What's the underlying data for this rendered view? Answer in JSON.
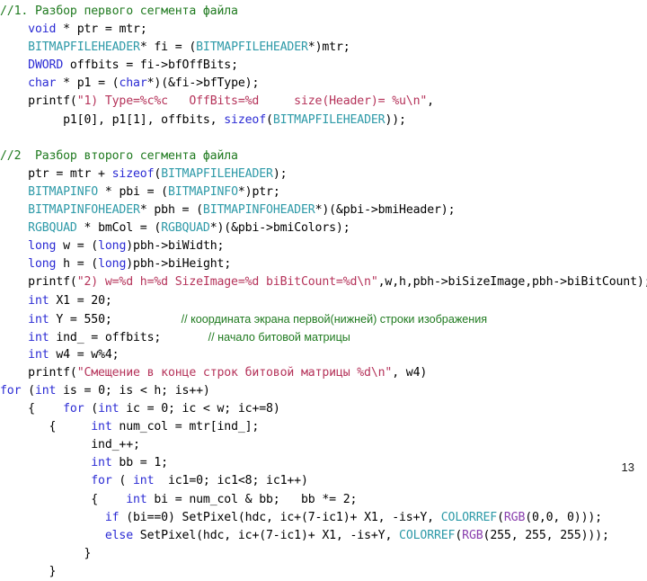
{
  "slide": {
    "page_number": "13",
    "background_color": "#ffffff",
    "colors": {
      "keyword": "#2b2bd4",
      "type": "#2e9aa8",
      "string": "#b5335a",
      "macro": "#8a3fae",
      "comment": "#1f7a1f",
      "plain": "#000000"
    }
  },
  "code_lines": [
    {
      "indent": 0,
      "tokens": [
        {
          "t": "cmt",
          "v": "//1. Разбор первого сегмента файла"
        }
      ]
    },
    {
      "indent": 0,
      "tokens": [
        {
          "t": "plain",
          "v": "    "
        },
        {
          "t": "kw",
          "v": "void"
        },
        {
          "t": "plain",
          "v": " * ptr = mtr;"
        }
      ]
    },
    {
      "indent": 0,
      "tokens": [
        {
          "t": "plain",
          "v": "    "
        },
        {
          "t": "typ",
          "v": "BITMAPFILEHEADER"
        },
        {
          "t": "plain",
          "v": "* fi = ("
        },
        {
          "t": "typ",
          "v": "BITMAPFILEHEADER"
        },
        {
          "t": "plain",
          "v": "*)mtr;"
        }
      ]
    },
    {
      "indent": 0,
      "tokens": [
        {
          "t": "plain",
          "v": "    "
        },
        {
          "t": "kw",
          "v": "DWORD"
        },
        {
          "t": "plain",
          "v": " offbits = fi->bfOffBits;"
        }
      ]
    },
    {
      "indent": 0,
      "tokens": [
        {
          "t": "plain",
          "v": "    "
        },
        {
          "t": "kw",
          "v": "char"
        },
        {
          "t": "plain",
          "v": " * p1 = ("
        },
        {
          "t": "kw",
          "v": "char"
        },
        {
          "t": "plain",
          "v": "*)(&fi->bfType);"
        }
      ]
    },
    {
      "indent": 0,
      "tokens": [
        {
          "t": "plain",
          "v": "    printf("
        },
        {
          "t": "str",
          "v": "\"1) Type=%c%c   OffBits=%d     size(Header)= %u\\n\""
        },
        {
          "t": "plain",
          "v": ","
        }
      ]
    },
    {
      "indent": 0,
      "tokens": [
        {
          "t": "plain",
          "v": "         p1[0], p1[1], offbits, "
        },
        {
          "t": "kw",
          "v": "sizeof"
        },
        {
          "t": "plain",
          "v": "("
        },
        {
          "t": "typ",
          "v": "BITMAPFILEHEADER"
        },
        {
          "t": "plain",
          "v": "));"
        }
      ]
    },
    {
      "indent": 0,
      "tokens": [
        {
          "t": "plain",
          "v": ""
        }
      ]
    },
    {
      "indent": 0,
      "tokens": [
        {
          "t": "cmt",
          "v": "//2  Разбор второго сегмента файла"
        }
      ]
    },
    {
      "indent": 0,
      "tokens": [
        {
          "t": "plain",
          "v": "    ptr = mtr + "
        },
        {
          "t": "kw",
          "v": "sizeof"
        },
        {
          "t": "plain",
          "v": "("
        },
        {
          "t": "typ",
          "v": "BITMAPFILEHEADER"
        },
        {
          "t": "plain",
          "v": ");"
        }
      ]
    },
    {
      "indent": 0,
      "tokens": [
        {
          "t": "plain",
          "v": "    "
        },
        {
          "t": "typ",
          "v": "BITMAPINFO"
        },
        {
          "t": "plain",
          "v": " * pbi = ("
        },
        {
          "t": "typ",
          "v": "BITMAPINFO"
        },
        {
          "t": "plain",
          "v": "*)ptr;"
        }
      ]
    },
    {
      "indent": 0,
      "tokens": [
        {
          "t": "plain",
          "v": "    "
        },
        {
          "t": "typ",
          "v": "BITMAPINFOHEADER"
        },
        {
          "t": "plain",
          "v": "* pbh = ("
        },
        {
          "t": "typ",
          "v": "BITMAPINFOHEADER"
        },
        {
          "t": "plain",
          "v": "*)(&pbi->bmiHeader);"
        }
      ]
    },
    {
      "indent": 0,
      "tokens": [
        {
          "t": "plain",
          "v": "    "
        },
        {
          "t": "typ",
          "v": "RGBQUAD"
        },
        {
          "t": "plain",
          "v": " * bmCol = ("
        },
        {
          "t": "typ",
          "v": "RGBQUAD"
        },
        {
          "t": "plain",
          "v": "*)(&pbi->bmiColors);"
        }
      ]
    },
    {
      "indent": 0,
      "tokens": [
        {
          "t": "plain",
          "v": "    "
        },
        {
          "t": "kw",
          "v": "long"
        },
        {
          "t": "plain",
          "v": " w = ("
        },
        {
          "t": "kw",
          "v": "long"
        },
        {
          "t": "plain",
          "v": ")pbh->biWidth;"
        }
      ]
    },
    {
      "indent": 0,
      "tokens": [
        {
          "t": "plain",
          "v": "    "
        },
        {
          "t": "kw",
          "v": "long"
        },
        {
          "t": "plain",
          "v": " h = ("
        },
        {
          "t": "kw",
          "v": "long"
        },
        {
          "t": "plain",
          "v": ")pbh->biHeight;"
        }
      ]
    },
    {
      "indent": 0,
      "tokens": [
        {
          "t": "plain",
          "v": "    printf("
        },
        {
          "t": "str",
          "v": "\"2) w=%d h=%d SizeImage=%d biBitCount=%d\\n\""
        },
        {
          "t": "plain",
          "v": ",w,h,pbh->biSizeImage,pbh->biBitCount);"
        }
      ]
    },
    {
      "indent": 0,
      "tokens": [
        {
          "t": "plain",
          "v": "    "
        },
        {
          "t": "kw",
          "v": "int"
        },
        {
          "t": "plain",
          "v": " X1 = 20;"
        }
      ]
    },
    {
      "indent": 0,
      "tokens": [
        {
          "t": "plain",
          "v": "    "
        },
        {
          "t": "kw",
          "v": "int"
        },
        {
          "t": "plain",
          "v": " Y = 550;"
        },
        {
          "t": "cmtprop",
          "v": "                      // координата экрана первой(нижней) строки изображения"
        }
      ]
    },
    {
      "indent": 0,
      "tokens": [
        {
          "t": "plain",
          "v": "    "
        },
        {
          "t": "kw",
          "v": "int"
        },
        {
          "t": "plain",
          "v": " ind_ = offbits;"
        },
        {
          "t": "cmtprop",
          "v": "               // начало битовой матрицы"
        }
      ]
    },
    {
      "indent": 0,
      "tokens": [
        {
          "t": "plain",
          "v": "    "
        },
        {
          "t": "kw",
          "v": "int"
        },
        {
          "t": "plain",
          "v": " w4 = w%4;"
        }
      ]
    },
    {
      "indent": 0,
      "tokens": [
        {
          "t": "plain",
          "v": "    printf("
        },
        {
          "t": "str",
          "v": "\"Смещение в конце строк битовой матрицы %d\\n\""
        },
        {
          "t": "plain",
          "v": ", w4)"
        }
      ]
    },
    {
      "indent": 0,
      "tokens": [
        {
          "t": "kw",
          "v": "for"
        },
        {
          "t": "plain",
          "v": " ("
        },
        {
          "t": "kw",
          "v": "int"
        },
        {
          "t": "plain",
          "v": " is = 0; is < h; is++)"
        }
      ]
    },
    {
      "indent": 0,
      "tokens": [
        {
          "t": "plain",
          "v": "    {    "
        },
        {
          "t": "kw",
          "v": "for"
        },
        {
          "t": "plain",
          "v": " ("
        },
        {
          "t": "kw",
          "v": "int"
        },
        {
          "t": "plain",
          "v": " ic = 0; ic < w; ic+=8)"
        }
      ]
    },
    {
      "indent": 0,
      "tokens": [
        {
          "t": "plain",
          "v": "       {     "
        },
        {
          "t": "kw",
          "v": "int"
        },
        {
          "t": "plain",
          "v": " num_col = mtr[ind_];"
        }
      ]
    },
    {
      "indent": 0,
      "tokens": [
        {
          "t": "plain",
          "v": "             ind_++;"
        }
      ]
    },
    {
      "indent": 0,
      "tokens": [
        {
          "t": "plain",
          "v": "             "
        },
        {
          "t": "kw",
          "v": "int"
        },
        {
          "t": "plain",
          "v": " bb = 1;"
        }
      ]
    },
    {
      "indent": 0,
      "tokens": [
        {
          "t": "plain",
          "v": "             "
        },
        {
          "t": "kw",
          "v": "for"
        },
        {
          "t": "plain",
          "v": " ( "
        },
        {
          "t": "kw",
          "v": "int"
        },
        {
          "t": "plain",
          "v": "  ic1=0; ic1<8; ic1++)"
        }
      ]
    },
    {
      "indent": 0,
      "tokens": [
        {
          "t": "plain",
          "v": "             {    "
        },
        {
          "t": "kw",
          "v": "int"
        },
        {
          "t": "plain",
          "v": " bi = num_col & bb;   bb *= 2;"
        }
      ]
    },
    {
      "indent": 0,
      "tokens": [
        {
          "t": "plain",
          "v": "               "
        },
        {
          "t": "kw",
          "v": "if"
        },
        {
          "t": "plain",
          "v": " (bi==0) SetPixel(hdc, ic+(7-ic1)+ X1, -is+Y, "
        },
        {
          "t": "typ",
          "v": "COLORREF"
        },
        {
          "t": "plain",
          "v": "("
        },
        {
          "t": "mac",
          "v": "RGB"
        },
        {
          "t": "plain",
          "v": "(0,0, 0)));"
        }
      ]
    },
    {
      "indent": 0,
      "tokens": [
        {
          "t": "plain",
          "v": "               "
        },
        {
          "t": "kw",
          "v": "else"
        },
        {
          "t": "plain",
          "v": " SetPixel(hdc, ic+(7-ic1)+ X1, -is+Y, "
        },
        {
          "t": "typ",
          "v": "COLORREF"
        },
        {
          "t": "plain",
          "v": "("
        },
        {
          "t": "mac",
          "v": "RGB"
        },
        {
          "t": "plain",
          "v": "(255, 255, 255)));"
        }
      ]
    },
    {
      "indent": 0,
      "tokens": [
        {
          "t": "plain",
          "v": "            }"
        }
      ]
    },
    {
      "indent": 0,
      "tokens": [
        {
          "t": "plain",
          "v": "       }"
        }
      ]
    }
  ]
}
